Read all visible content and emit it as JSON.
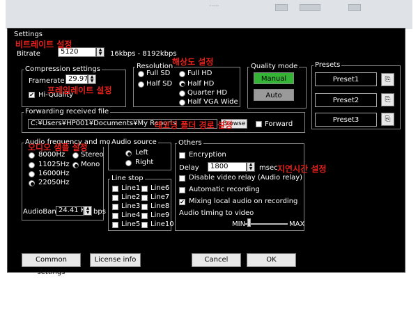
{
  "window": {
    "title": "Settings"
  },
  "bitrate": {
    "label": "Bitrate",
    "value": "5120",
    "range": "16kbps - 8192kbps"
  },
  "compression": {
    "title": "Compression settings",
    "framerate_label": "Framerate",
    "framerate_value": "29.97",
    "hiquality_label": "Hi-Quality"
  },
  "resolution": {
    "title": "Resolution",
    "options": [
      "Full SD",
      "Half SD",
      "Full HD",
      "Half HD",
      "Quarter HD",
      "Half VGA Wide"
    ],
    "selected": "Half HD"
  },
  "quality_mode": {
    "title": "Quality mode",
    "manual": "Manual",
    "auto": "Auto",
    "selected": "Manual"
  },
  "presets": {
    "title": "Presets",
    "items": [
      "Preset1",
      "Preset2",
      "Preset3"
    ]
  },
  "forwarding": {
    "title": "Forwarding received file",
    "path": "C:¥Users¥HP001¥Documents¥My Reports",
    "browse_label": "Browse",
    "forward_label": "Forward"
  },
  "audio_freq": {
    "title": "Audio frequency and mode",
    "freqs": [
      "8000Hz",
      "11025Hz",
      "16000Hz",
      "22050Hz"
    ],
    "selected_freq": "22050Hz",
    "modes": [
      "Stereo",
      "Mono"
    ],
    "selected_mode": "Mono",
    "audioband_label": "AudioBand",
    "audioband_value": "24.41 K",
    "audioband_unit": "bps"
  },
  "audio_source": {
    "title": "Audio source",
    "options": [
      "Left",
      "Right"
    ],
    "selected": "Left"
  },
  "line_stop": {
    "title": "Line stop",
    "items": [
      "Line1",
      "Line6",
      "Line2",
      "Line7",
      "Line3",
      "Line8",
      "Line4",
      "Line9",
      "Line5",
      "Line10"
    ]
  },
  "others": {
    "title": "Others",
    "encryption": "Encryption",
    "delay_label": "Delay",
    "delay_value": "1800",
    "delay_unit": "msec",
    "disable_relay": "Disable video relay (Audio relay)",
    "auto_recording": "Automatic recording",
    "mixing": "Mixing local audio on recording",
    "timing_label": "Audio timing to video",
    "timing_min": "MIN",
    "timing_max": "MAX",
    "mixing_checked": true
  },
  "footer": {
    "common": "Common settings",
    "license": "License info",
    "cancel": "Cancel",
    "ok": "OK"
  },
  "annotations": {
    "bitrate": "비트레이트 설정",
    "framerate": "프레임레이트 설정",
    "resolution": "해상도 설정",
    "folder": "레코딩 폴더 경로 설정",
    "audio": "오디오 샘플 설정",
    "delay": "지연시간 설정"
  },
  "colors": {
    "manual_green": "#35b535",
    "annotation_red": "#e3211c",
    "panel_black": "#000000"
  }
}
